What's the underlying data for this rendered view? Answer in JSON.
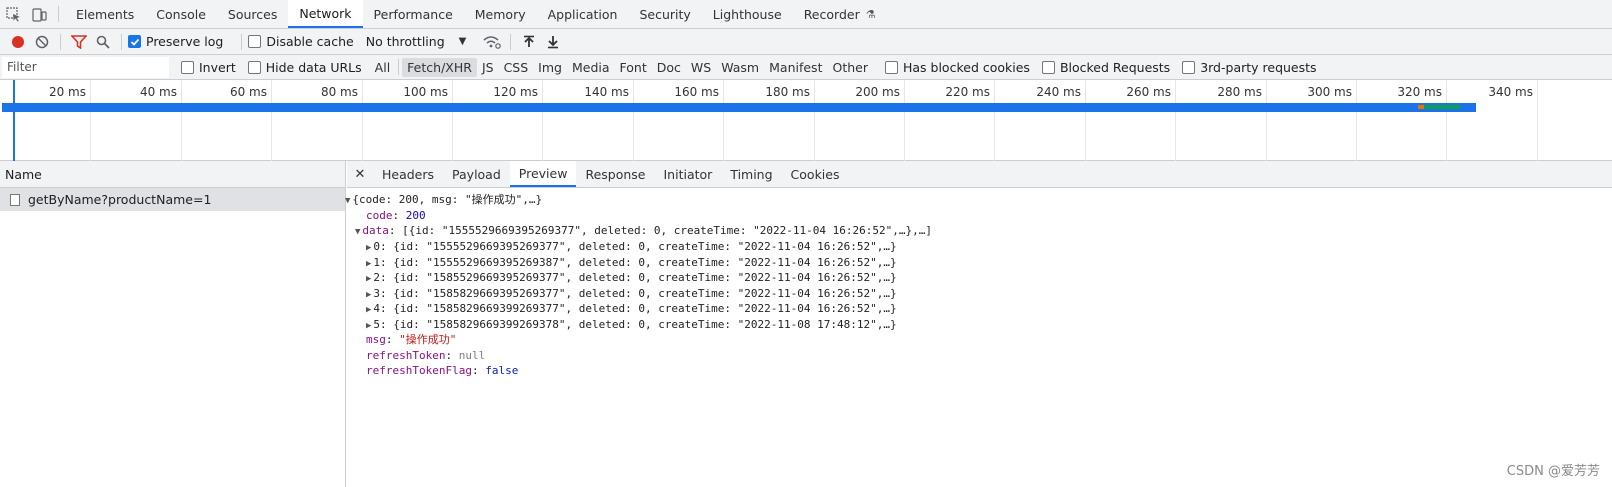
{
  "topbar": {
    "tabs": [
      {
        "label": "Elements"
      },
      {
        "label": "Console"
      },
      {
        "label": "Sources"
      },
      {
        "label": "Network",
        "active": true
      },
      {
        "label": "Performance"
      },
      {
        "label": "Memory"
      },
      {
        "label": "Application"
      },
      {
        "label": "Security"
      },
      {
        "label": "Lighthouse"
      },
      {
        "label": "Recorder"
      }
    ]
  },
  "toolbar": {
    "preserve_log": "Preserve log",
    "disable_cache": "Disable cache",
    "throttling": "No throttling"
  },
  "filterbar": {
    "placeholder": "Filter",
    "invert": "Invert",
    "hide_data_urls": "Hide data URLs",
    "types": [
      "All",
      "Fetch/XHR",
      "JS",
      "CSS",
      "Img",
      "Media",
      "Font",
      "Doc",
      "WS",
      "Wasm",
      "Manifest",
      "Other"
    ],
    "active_type": "Fetch/XHR",
    "has_blocked_cookies": "Has blocked cookies",
    "blocked_requests": "Blocked Requests",
    "third_party": "3rd-party requests"
  },
  "timeline": {
    "ticks": [
      "20 ms",
      "40 ms",
      "60 ms",
      "80 ms",
      "100 ms",
      "120 ms",
      "140 ms",
      "160 ms",
      "180 ms",
      "200 ms",
      "220 ms",
      "240 ms",
      "260 ms",
      "280 ms",
      "300 ms",
      "320 ms",
      "340 ms"
    ],
    "request_duration_ms": 322
  },
  "namepanel": {
    "header": "Name",
    "rows": [
      "getByName?productName=1"
    ]
  },
  "detail": {
    "tabs": [
      "Headers",
      "Payload",
      "Preview",
      "Response",
      "Initiator",
      "Timing",
      "Cookies"
    ],
    "active_tab": "Preview"
  },
  "preview": {
    "root": "{code: 200, msg: \"操作成功\",…}",
    "code_key": "code",
    "code_val": "200",
    "data_key": "data",
    "data_summary": "[{id: \"1555529669395269377\", deleted: 0, createTime: \"2022-11-04 16:26:52\",…},…]",
    "items": [
      "0: {id: \"1555529669395269377\", deleted: 0, createTime: \"2022-11-04 16:26:52\",…}",
      "1: {id: \"1555529669395269387\", deleted: 0, createTime: \"2022-11-04 16:26:52\",…}",
      "2: {id: \"1585529669395269377\", deleted: 0, createTime: \"2022-11-04 16:26:52\",…}",
      "3: {id: \"1585829669395269377\", deleted: 0, createTime: \"2022-11-04 16:26:52\",…}",
      "4: {id: \"1585829669399269377\", deleted: 0, createTime: \"2022-11-04 16:26:52\",…}",
      "5: {id: \"1585829669399269378\", deleted: 0, createTime: \"2022-11-08 17:48:12\",…}"
    ],
    "msg_key": "msg",
    "msg_val": "\"操作成功\"",
    "refresh_key": "refreshToken",
    "refresh_val": "null",
    "flag_key": "refreshTokenFlag",
    "flag_val": "false"
  },
  "watermark": "CSDN @爱芳芳",
  "colors": {
    "accent": "#1a73e8",
    "record": "#d93025",
    "filter": "#d93025",
    "bar_green": "#0f9d58"
  }
}
